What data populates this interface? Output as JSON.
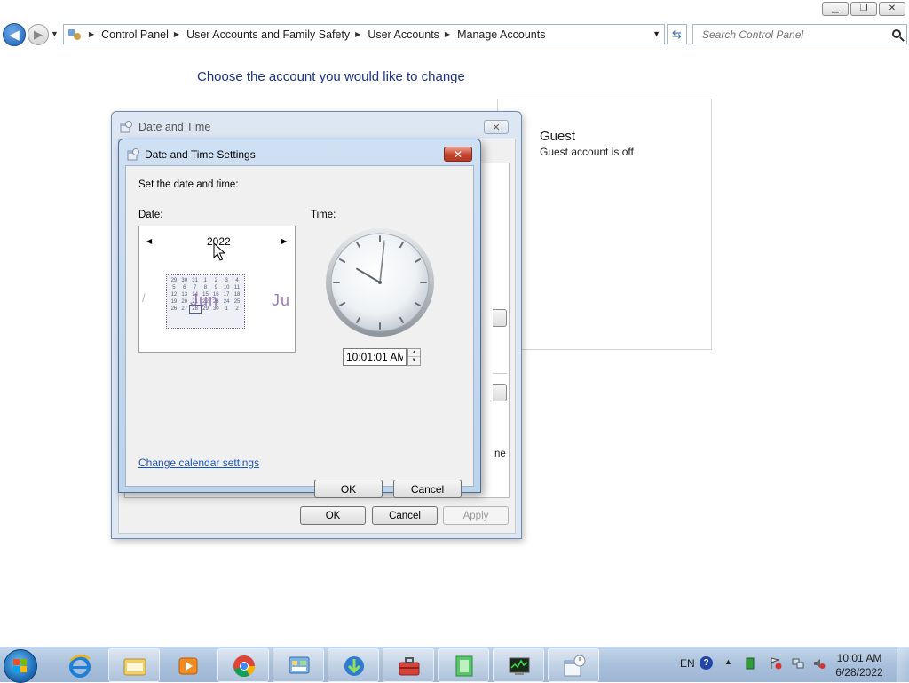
{
  "window": {
    "breadcrumb": [
      "Control Panel",
      "User Accounts and Family Safety",
      "User Accounts",
      "Manage Accounts"
    ],
    "search_placeholder": "Search Control Panel"
  },
  "page": {
    "heading": "Choose the account you would like to change",
    "guest_name": "Guest",
    "guest_status": "Guest account is off"
  },
  "outer_dialog": {
    "title": "Date and Time",
    "ok_label": "OK",
    "cancel_label": "Cancel",
    "apply_label": "Apply",
    "obscured_text": "ne"
  },
  "settings_dialog": {
    "title": "Date and Time Settings",
    "instruction": "Set the date and time:",
    "date_label": "Date:",
    "time_label": "Time:",
    "calendar": {
      "year": "2022",
      "prev_month_fragment": "/",
      "current_month": "Jun",
      "next_month_fragment": "Ju",
      "weeks": [
        [
          "29",
          "30",
          "31",
          "1",
          "2",
          "3",
          "4"
        ],
        [
          "5",
          "6",
          "7",
          "8",
          "9",
          "10",
          "11"
        ],
        [
          "12",
          "13",
          "14",
          "15",
          "16",
          "17",
          "18"
        ],
        [
          "19",
          "20",
          "21",
          "22",
          "23",
          "24",
          "25"
        ],
        [
          "26",
          "27",
          "28",
          "29",
          "30",
          "1",
          "2"
        ]
      ],
      "selected_day": "28"
    },
    "clock": {
      "hour": 10,
      "minute": 1,
      "second": 1
    },
    "time_value": "10:01:01 AM",
    "change_calendar_link": "Change calendar settings",
    "ok_label": "OK",
    "cancel_label": "Cancel"
  },
  "taskbar": {
    "language": "EN",
    "help_glyph": "?",
    "time": "10:01 AM",
    "date": "6/28/2022",
    "apps": [
      "internet-explorer",
      "windows-explorer",
      "media-player",
      "google-chrome",
      "control-panel",
      "download-manager",
      "toolbox-app",
      "green-app",
      "task-manager",
      "date-and-time"
    ]
  },
  "colors": {
    "heading": "#1e3287",
    "link": "#1c54b8",
    "taskbar": "#aac1dc",
    "close_red": "#c2422c"
  }
}
